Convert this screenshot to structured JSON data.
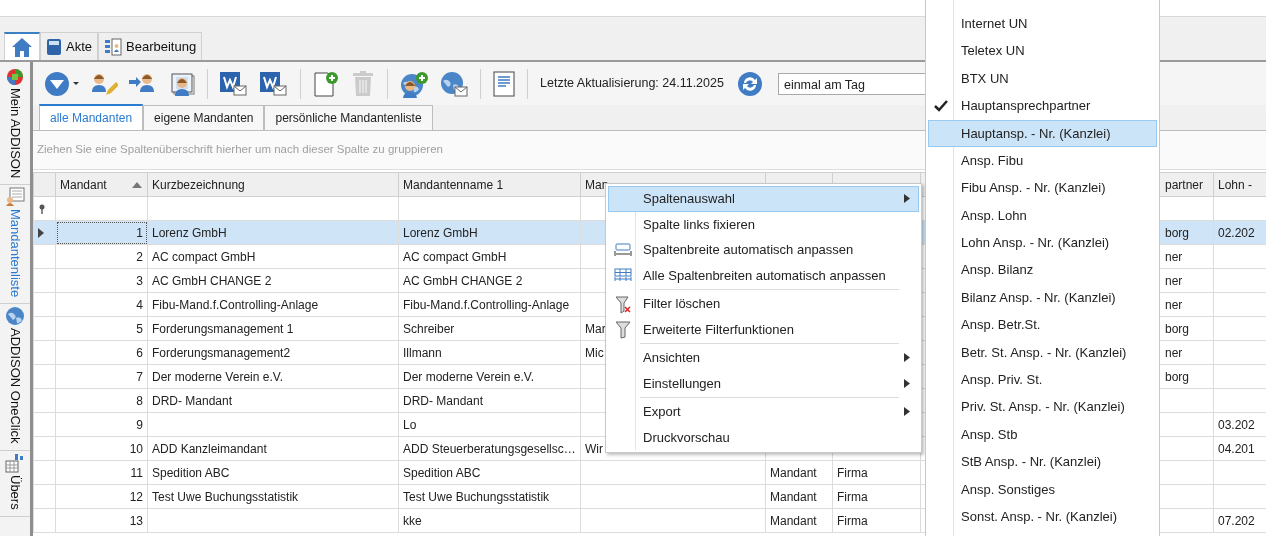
{
  "ribbon_tabs": [
    {
      "kind": "home",
      "selected": true
    },
    {
      "kind": "book",
      "label": "Akte",
      "selected": false
    },
    {
      "kind": "form",
      "label": "Bearbeitung",
      "selected": false
    }
  ],
  "sidebar": {
    "items": [
      {
        "kind": "ring",
        "label": "Mein ADDISON",
        "selected": false
      },
      {
        "kind": "list",
        "label": "Mandantenliste",
        "selected": true
      },
      {
        "kind": "globe",
        "label": "ADDISON OneClick",
        "selected": false
      },
      {
        "kind": "chart",
        "label": "Übers",
        "selected": false
      }
    ]
  },
  "toolbar": {
    "groups": [
      [
        {
          "kind": "dropdown",
          "disabled": false
        },
        {
          "kind": "person-edit",
          "disabled": false
        },
        {
          "kind": "person-arrow",
          "disabled": false
        },
        {
          "kind": "portrait",
          "disabled": false
        }
      ],
      [
        {
          "kind": "doc-mail",
          "disabled": false
        },
        {
          "kind": "doc-mail",
          "disabled": false
        }
      ],
      [
        {
          "kind": "doc-plus",
          "disabled": false
        },
        {
          "kind": "trash",
          "disabled": true
        }
      ],
      [
        {
          "kind": "globe-plus",
          "disabled": false
        },
        {
          "kind": "globe-mail",
          "disabled": false
        }
      ],
      [
        {
          "kind": "note",
          "disabled": false
        }
      ]
    ],
    "last_update": "Letzte Aktualisierung: 24.11.2025",
    "interval": {
      "value": "einmal am Tag"
    }
  },
  "tabs": [
    {
      "label": "alle Mandanten",
      "selected": true
    },
    {
      "label": "eigene Mandanten",
      "selected": false
    },
    {
      "label": "persönliche Mandantenliste",
      "selected": false
    }
  ],
  "group_panel": {
    "hint": "Ziehen Sie eine Spaltenüberschrift hierher um nach dieser Spalte zu gruppieren"
  },
  "table": {
    "header": {
      "mandant": {
        "label": "Mandant",
        "sorted": true
      },
      "kurzbezeichnung": {
        "label": "Kurzbezeichnung",
        "sorted": false
      },
      "mandantenname_1": {
        "label": "Mandantenname 1",
        "sorted": false
      },
      "column_4": {
        "label": "Man",
        "sorted": false
      },
      "column_8": {
        "label": "partner",
        "sorted": false
      },
      "column_9": {
        "label": "Lohn -",
        "sorted": false
      }
    },
    "rows": [
      {
        "selected": true,
        "mandant": "1",
        "kurzbezeichnung": "Lorenz GmbH",
        "mandantenname_1": "Lorenz GmbH",
        "column_8": "borg",
        "column_9": "02.202"
      },
      {
        "selected": false,
        "mandant": "2",
        "kurzbezeichnung": "AC compact GmbH",
        "mandantenname_1": "AC compact GmbH",
        "column_8": "ner"
      },
      {
        "selected": false,
        "mandant": "3",
        "kurzbezeichnung": "AC GmbH CHANGE 2",
        "mandantenname_1": "AC GmbH CHANGE 2",
        "column_8": "ner"
      },
      {
        "selected": false,
        "mandant": "4",
        "kurzbezeichnung": "Fibu-Mand.f.Controlling-Anlage",
        "mandantenname_1": "Fibu-Mand.f.Controlling-Anlage",
        "column_8": "ner"
      },
      {
        "selected": false,
        "mandant": "5",
        "kurzbezeichnung": "Forderungsmanagement 1",
        "mandantenname_1": "Schreiber",
        "column_4": "Mar",
        "column_8": "borg"
      },
      {
        "selected": false,
        "mandant": "6",
        "kurzbezeichnung": "Forderungsmanagement2",
        "mandantenname_1": "Illmann",
        "column_4": "Mic",
        "column_8": "ner"
      },
      {
        "selected": false,
        "mandant": "7",
        "kurzbezeichnung": "Der moderne Verein e.V.",
        "mandantenname_1": "Der moderne Verein e.V.",
        "column_8": "borg"
      },
      {
        "selected": false,
        "mandant": "8",
        "kurzbezeichnung": "DRD- Mandant",
        "mandantenname_1": "DRD- Mandant"
      },
      {
        "selected": false,
        "mandant": "9",
        "mandantenname_1": "Lo",
        "column_9": "03.202"
      },
      {
        "selected": false,
        "mandant": "10",
        "kurzbezeichnung": "ADD Kanzleimandant",
        "mandantenname_1": "ADD Steuerberatungsgesellsc…",
        "column_4": "Wir",
        "column_9": "04.201"
      },
      {
        "selected": false,
        "mandant": "11",
        "kurzbezeichnung": "Spedition ABC",
        "mandantenname_1": "Spedition ABC",
        "column_5": "Mandant",
        "column_6": "Firma"
      },
      {
        "selected": false,
        "mandant": "12",
        "kurzbezeichnung": "Test Uwe Buchungsstatistik",
        "mandantenname_1": "Test Uwe Buchungsstatistik",
        "column_5": "Mandant",
        "column_6": "Firma"
      },
      {
        "selected": false,
        "mandant": "13",
        "mandantenname_1": "kke",
        "column_5": "Mandant",
        "column_6": "Firma",
        "column_9": "07.202"
      }
    ]
  },
  "context_menu": {
    "items": [
      {
        "kind": "plain",
        "label": "Spaltenauswahl",
        "has_submenu": true,
        "selected": true
      },
      {
        "kind": "plain",
        "label": "Spalte links fixieren",
        "has_submenu": false,
        "selected": false
      },
      {
        "kind": "autofit",
        "label": "Spaltenbreite automatisch anpassen",
        "has_submenu": false,
        "selected": false
      },
      {
        "kind": "autofit-all",
        "label": "Alle Spaltenbreiten automatisch anpassen",
        "has_submenu": false,
        "selected": false
      },
      {
        "kind": "separator"
      },
      {
        "kind": "filter-clear",
        "label": "Filter löschen",
        "has_submenu": false,
        "selected": false
      },
      {
        "kind": "filter",
        "label": "Erweiterte Filterfunktionen",
        "has_submenu": false,
        "selected": false
      },
      {
        "kind": "separator"
      },
      {
        "kind": "plain",
        "label": "Ansichten",
        "has_submenu": true,
        "selected": false
      },
      {
        "kind": "plain",
        "label": "Einstellungen",
        "has_submenu": true,
        "selected": false
      },
      {
        "kind": "separator"
      },
      {
        "kind": "plain",
        "label": "Export",
        "has_submenu": true,
        "selected": false
      },
      {
        "kind": "plain",
        "label": "Druckvorschau",
        "has_submenu": false,
        "selected": false
      }
    ]
  },
  "submenu": {
    "items": [
      {
        "label": "Internet UN",
        "checked": false,
        "selected": false
      },
      {
        "label": "Teletex UN",
        "checked": false,
        "selected": false
      },
      {
        "label": "BTX UN",
        "checked": false,
        "selected": false
      },
      {
        "label": "Hauptansprechpartner",
        "checked": true,
        "selected": false
      },
      {
        "label": "Hauptansp. - Nr. (Kanzlei)",
        "checked": false,
        "selected": true
      },
      {
        "label": "Ansp. Fibu",
        "checked": false,
        "selected": false
      },
      {
        "label": "Fibu Ansp. - Nr. (Kanzlei)",
        "checked": false,
        "selected": false
      },
      {
        "label": "Ansp. Lohn",
        "checked": false,
        "selected": false
      },
      {
        "label": "Lohn Ansp. - Nr. (Kanzlei)",
        "checked": false,
        "selected": false
      },
      {
        "label": "Ansp. Bilanz",
        "checked": false,
        "selected": false
      },
      {
        "label": "Bilanz Ansp. - Nr. (Kanzlei)",
        "checked": false,
        "selected": false
      },
      {
        "label": "Ansp. Betr.St.",
        "checked": false,
        "selected": false
      },
      {
        "label": "Betr. St. Ansp. - Nr. (Kanzlei)",
        "checked": false,
        "selected": false
      },
      {
        "label": "Ansp. Priv. St.",
        "checked": false,
        "selected": false
      },
      {
        "label": "Priv. St. Ansp. - Nr. (Kanzlei)",
        "checked": false,
        "selected": false
      },
      {
        "label": "Ansp. Stb",
        "checked": false,
        "selected": false
      },
      {
        "label": "StB Ansp. - Nr. (Kanzlei)",
        "checked": false,
        "selected": false
      },
      {
        "label": "Ansp. Sonstiges",
        "checked": false,
        "selected": false
      },
      {
        "label": "Sonst. Ansp. - Nr. (Kanzlei)",
        "checked": false,
        "selected": false
      }
    ]
  }
}
